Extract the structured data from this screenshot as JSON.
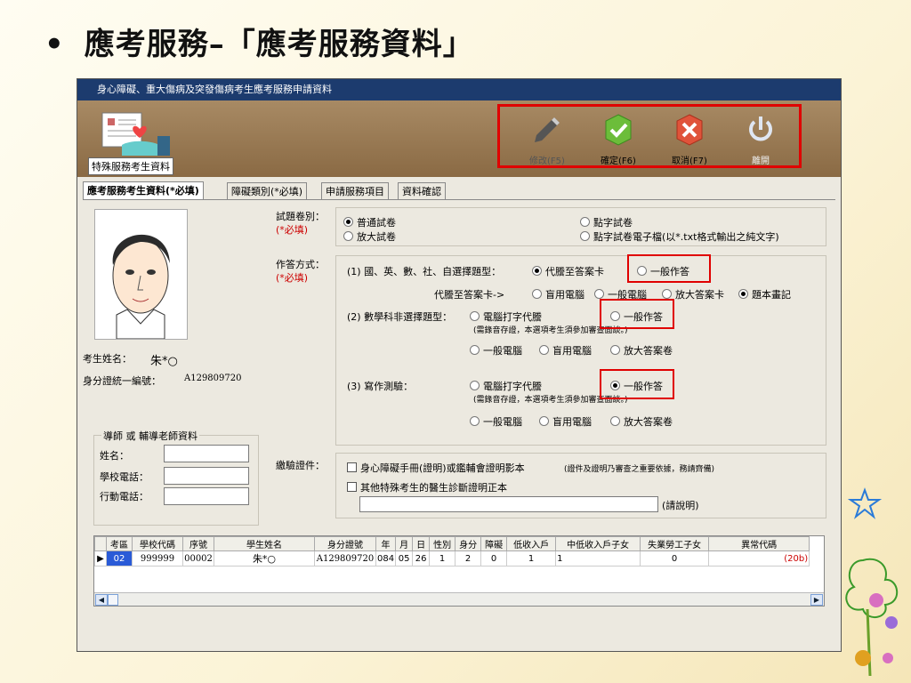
{
  "slide": {
    "bullet": "•",
    "title": "應考服務–「應考服務資料」"
  },
  "window": {
    "title": "身心障礙、重大傷病及突發傷病考生應考服務申請資料",
    "banner_label": "特殊服務考生資料"
  },
  "toolbar": {
    "modify": "修改(F5)",
    "confirm": "確定(F6)",
    "cancel": "取消(F7)",
    "exit": "離開"
  },
  "tabs": [
    {
      "label": "應考服務考生資料(*必填)",
      "active": true
    },
    {
      "label": "障礙類別(*必填)"
    },
    {
      "label": "申請服務項目"
    },
    {
      "label": "資料確認"
    }
  ],
  "student": {
    "name_label": "考生姓名：",
    "name_value": "朱*○",
    "id_label": "身分證統一編號：",
    "id_value": "A129809720"
  },
  "teacher": {
    "legend": "導師 或 輔導老師資料",
    "name_label": "姓名：",
    "school_phone_label": "學校電話：",
    "mobile_label": "行動電話："
  },
  "exam_paper": {
    "label": "試題卷別：",
    "required": "(*必填)",
    "options": [
      "普通試卷",
      "放大試卷",
      "點字試卷",
      "點字試卷電子檔(以*.txt格式輸出之純文字)"
    ]
  },
  "answer_method": {
    "label": "作答方式：",
    "required": "(*必填)",
    "q1_label": "(1) 國、英、數、社、自選擇題型：",
    "q1_opt_a": "代謄至答案卡",
    "q1_opt_b": "一般作答",
    "q1_sub_label": "代謄至答案卡->",
    "q1_sub_opts": [
      "盲用電腦",
      "一般電腦",
      "放大答案卡",
      "題本畫記"
    ],
    "q2_label": "(2) 數學科非選擇題型：",
    "q2_opt_a": "電腦打字代謄",
    "q2_opt_b": "一般作答",
    "q2_note": "(需錄音存證，本選項考生須參加審查面談。)",
    "q2_row2": [
      "一般電腦",
      "盲用電腦",
      "放大答案卷"
    ],
    "q3_label": "(3) 寫作測驗：",
    "q3_opt_a": "電腦打字代謄",
    "q3_opt_b": "一般作答",
    "q3_note": "(需錄音存證，本選項考生須參加審查面談。)",
    "q3_row2": [
      "一般電腦",
      "盲用電腦",
      "放大答案卷"
    ]
  },
  "documents": {
    "label": "繳驗證件：",
    "item1": "身心障礙手冊(證明)或鑑輔會證明影本",
    "item1_note": "(證件及證明乃審查之重要依據，務請齊備)",
    "item2": "其他特殊考生的醫生診斷證明正本",
    "explain": "(請說明)"
  },
  "grid": {
    "columns": [
      "考區",
      "學校代碼",
      "序號",
      "學生姓名",
      "身分證號",
      "年",
      "月",
      "日",
      "性別",
      "身分",
      "障礙",
      "低收入戶",
      "中低收入戶子女",
      "失業勞工子女",
      "異常代碼"
    ],
    "rows": [
      [
        "02",
        "999999",
        "00002",
        "朱*○",
        "A129809720",
        "084",
        "05",
        "26",
        "1",
        "2",
        "0",
        "1",
        "1",
        "0",
        "(20b)"
      ]
    ]
  },
  "colors": {
    "titlebar": "#1c3b6e",
    "highlight": "#e00000",
    "required": "#cc0000"
  }
}
